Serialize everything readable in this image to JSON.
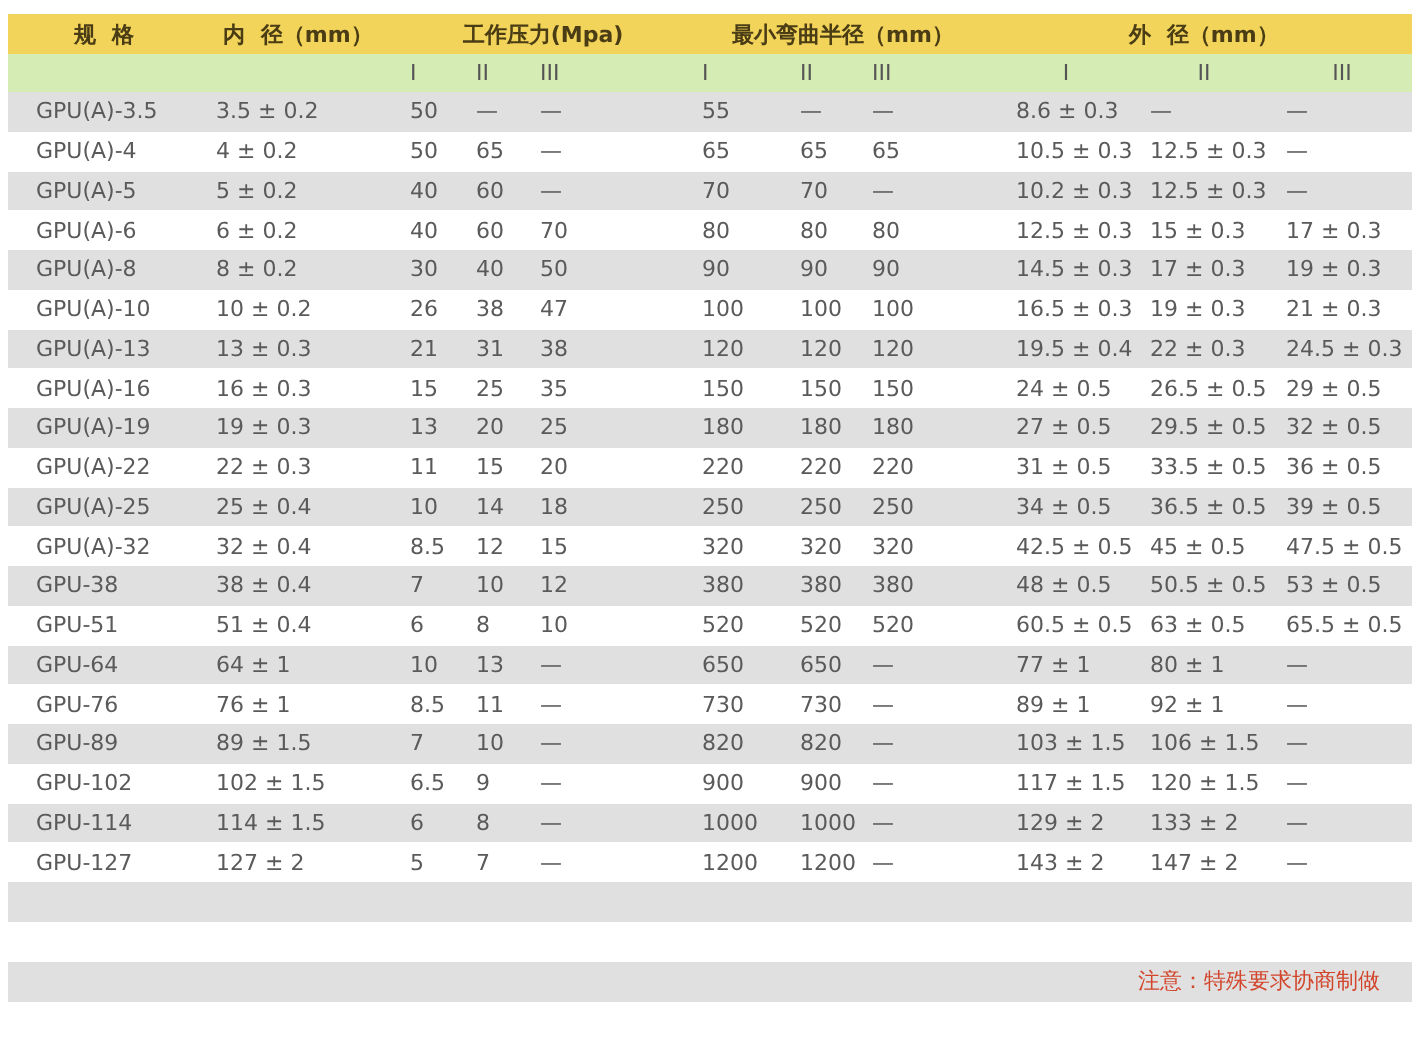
{
  "table": {
    "header_groups": [
      "规  格",
      "内  径（mm）",
      "工作压力(Mpa)",
      "最小弯曲半径（mm）",
      "外  径（mm）"
    ],
    "subheaders": [
      "I",
      "II",
      "III",
      "I",
      "II",
      "III",
      "I",
      "II",
      "III"
    ],
    "rows": [
      [
        "GPU(A)-3.5",
        "3.5 ± 0.2",
        "50",
        "—",
        "—",
        "55",
        "—",
        "—",
        "8.6 ± 0.3",
        "—",
        "—"
      ],
      [
        "GPU(A)-4",
        "4 ± 0.2",
        "50",
        "65",
        "—",
        "65",
        "65",
        "65",
        "10.5 ± 0.3",
        "12.5 ± 0.3",
        "—"
      ],
      [
        "GPU(A)-5",
        "5 ± 0.2",
        "40",
        "60",
        "—",
        "70",
        "70",
        "—",
        "10.2 ± 0.3",
        "12.5 ± 0.3",
        "—"
      ],
      [
        "GPU(A)-6",
        "6 ± 0.2",
        "40",
        "60",
        "70",
        "80",
        "80",
        "80",
        "12.5 ± 0.3",
        "15 ± 0.3",
        "17 ± 0.3"
      ],
      [
        "GPU(A)-8",
        "8 ± 0.2",
        "30",
        "40",
        "50",
        "90",
        "90",
        "90",
        "14.5 ± 0.3",
        "17 ± 0.3",
        "19 ± 0.3"
      ],
      [
        "GPU(A)-10",
        "10 ± 0.2",
        "26",
        "38",
        "47",
        "100",
        "100",
        "100",
        "16.5 ± 0.3",
        "19 ± 0.3",
        "21 ± 0.3"
      ],
      [
        "GPU(A)-13",
        "13 ± 0.3",
        "21",
        "31",
        "38",
        "120",
        "120",
        "120",
        "19.5 ± 0.4",
        "22 ± 0.3",
        "24.5 ± 0.3"
      ],
      [
        "GPU(A)-16",
        "16 ± 0.3",
        "15",
        "25",
        "35",
        "150",
        "150",
        "150",
        "24 ± 0.5",
        "26.5 ± 0.5",
        "29 ± 0.5"
      ],
      [
        "GPU(A)-19",
        "19 ± 0.3",
        "13",
        "20",
        "25",
        "180",
        "180",
        "180",
        "27 ± 0.5",
        "29.5 ± 0.5",
        "32 ± 0.5"
      ],
      [
        "GPU(A)-22",
        "22 ± 0.3",
        "11",
        "15",
        "20",
        "220",
        "220",
        "220",
        "31 ± 0.5",
        "33.5 ± 0.5",
        "36 ± 0.5"
      ],
      [
        "GPU(A)-25",
        "25 ± 0.4",
        "10",
        "14",
        "18",
        "250",
        "250",
        "250",
        "34 ± 0.5",
        "36.5 ± 0.5",
        "39 ± 0.5"
      ],
      [
        "GPU(A)-32",
        "32 ± 0.4",
        "8.5",
        "12",
        "15",
        "320",
        "320",
        "320",
        "42.5 ± 0.5",
        "45 ± 0.5",
        "47.5 ± 0.5"
      ],
      [
        "GPU-38",
        "38 ± 0.4",
        "7",
        "10",
        "12",
        "380",
        "380",
        "380",
        "48 ± 0.5",
        "50.5 ± 0.5",
        "53 ± 0.5"
      ],
      [
        "GPU-51",
        "51 ± 0.4",
        "6",
        "8",
        "10",
        "520",
        "520",
        "520",
        "60.5 ± 0.5",
        "63 ± 0.5",
        "65.5 ± 0.5"
      ],
      [
        "GPU-64",
        "64 ± 1",
        "10",
        "13",
        "—",
        "650",
        "650",
        "—",
        "77 ± 1",
        "80 ± 1",
        "—"
      ],
      [
        "GPU-76",
        "76 ± 1",
        "8.5",
        "11",
        "—",
        "730",
        "730",
        "—",
        "89 ± 1",
        "92 ± 1",
        "—"
      ],
      [
        "GPU-89",
        "89 ± 1.5",
        "7",
        "10",
        "—",
        "820",
        "820",
        "—",
        "103 ± 1.5",
        "106 ± 1.5",
        "—"
      ],
      [
        "GPU-102",
        "102 ± 1.5",
        "6.5",
        "9",
        "—",
        "900",
        "900",
        "—",
        "117 ± 1.5",
        "120 ± 1.5",
        "—"
      ],
      [
        "GPU-114",
        "114 ± 1.5",
        "6",
        "8",
        "—",
        "1000",
        "1000",
        "—",
        "129 ± 2",
        "133 ± 2",
        "—"
      ],
      [
        "GPU-127",
        "127 ± 2",
        "5",
        "7",
        "—",
        "1200",
        "1200",
        "—",
        "143 ± 2",
        "147 ± 2",
        "—"
      ]
    ],
    "note": "注意：特殊要求协商制做"
  }
}
